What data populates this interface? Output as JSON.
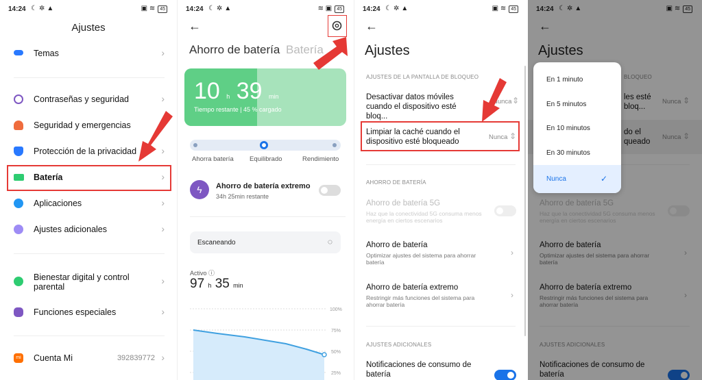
{
  "status": {
    "s1": {
      "time": "14:24",
      "battery": "45"
    },
    "s2": {
      "time": "14:24",
      "battery": "45"
    },
    "s3": {
      "time": "14:24",
      "battery": "45"
    },
    "s4": {
      "time": "14:24",
      "battery": "45"
    }
  },
  "screen1": {
    "title": "Ajustes",
    "items": [
      {
        "label": "Temas",
        "icon": "palette-icon",
        "color": "#2979ff"
      },
      {
        "label": "Contraseñas y seguridad",
        "icon": "fingerprint-icon",
        "color": "#7e57c2"
      },
      {
        "label": "Seguridad y emergencias",
        "icon": "emergency-icon",
        "color": "#ef6c3d"
      },
      {
        "label": "Protección de la privacidad",
        "icon": "shield-icon",
        "color": "#2979ff"
      },
      {
        "label": "Batería",
        "icon": "battery-icon",
        "color": "#2ecc71"
      },
      {
        "label": "Aplicaciones",
        "icon": "gear-icon",
        "color": "#2196f3"
      },
      {
        "label": "Ajustes adicionales",
        "icon": "dots-icon",
        "color": "#9e8cf5"
      },
      {
        "label": "Bienestar digital y control parental",
        "icon": "wellbeing-icon",
        "color": "#2ecc71"
      },
      {
        "label": "Funciones especiales",
        "icon": "special-icon",
        "color": "#7e57c2"
      },
      {
        "label": "Cuenta Mi",
        "icon": "mi-icon",
        "color": "#ff6f00",
        "value": "392839772"
      }
    ]
  },
  "screen2": {
    "tab_active": "Ahorro de batería",
    "tab_inactive": "Batería",
    "battery": {
      "hours": "10",
      "h_unit": "h",
      "minutes": "39",
      "min_unit": "min",
      "subtitle": "Tiempo restante | 45 % cargado",
      "level_percent": 45
    },
    "modes": [
      "Ahorra batería",
      "Equilibrado",
      "Rendimiento"
    ],
    "active_mode": "Equilibrado",
    "extreme": {
      "title": "Ahorro de batería extremo",
      "subtitle": "34h 25min restante",
      "enabled": false
    },
    "scan_label": "Escaneando",
    "activo": {
      "label": "Activo",
      "hours": "97",
      "h_unit": "h",
      "minutes": "35",
      "min_unit": "min"
    },
    "chart_ticks": [
      "100%",
      "75%",
      "50%",
      "25%"
    ]
  },
  "screen3": {
    "title": "Ajustes",
    "section_lock": "AJUSTES DE LA PANTALLA DE BLOQUEO",
    "row_mobile_data": {
      "title": "Desactivar datos móviles cuando el dispositivo esté bloq...",
      "value": "Nunca"
    },
    "row_cache": {
      "title": "Limpiar la caché cuando el dispositivo esté bloqueado",
      "value": "Nunca"
    },
    "section_battery": "AHORRO DE BATERÍA",
    "row_5g": {
      "title": "Ahorro de batería 5G",
      "subtitle": "Haz que la conectividad 5G consuma menos energía en ciertos escenarios"
    },
    "row_saver": {
      "title": "Ahorro de batería",
      "subtitle": "Optimizar ajustes del sistema para ahorrar batería"
    },
    "row_extreme": {
      "title": "Ahorro de batería extremo",
      "subtitle": "Restringir más funciones del sistema para ahorrar batería"
    },
    "section_extra": "AJUSTES ADICIONALES",
    "row_notif": {
      "title": "Notificaciones de consumo de batería",
      "enabled": true
    }
  },
  "screen4": {
    "title": "Ajustes",
    "section_lock_partial": "BLOQUEO",
    "row_mobile_data_partial": "les esté bloq...",
    "row_mobile_data_value": "Nunca",
    "row_cache_partial": "do el queado",
    "row_cache_value": "Nunca",
    "options": [
      "En 1 minuto",
      "En 5 minutos",
      "En 10 minutos",
      "En 30 minutos",
      "Nunca"
    ],
    "selected": "Nunca"
  },
  "colors": {
    "accent": "#1a73e8",
    "highlight_red": "#e53935",
    "battery_green": "#5fcf86"
  }
}
